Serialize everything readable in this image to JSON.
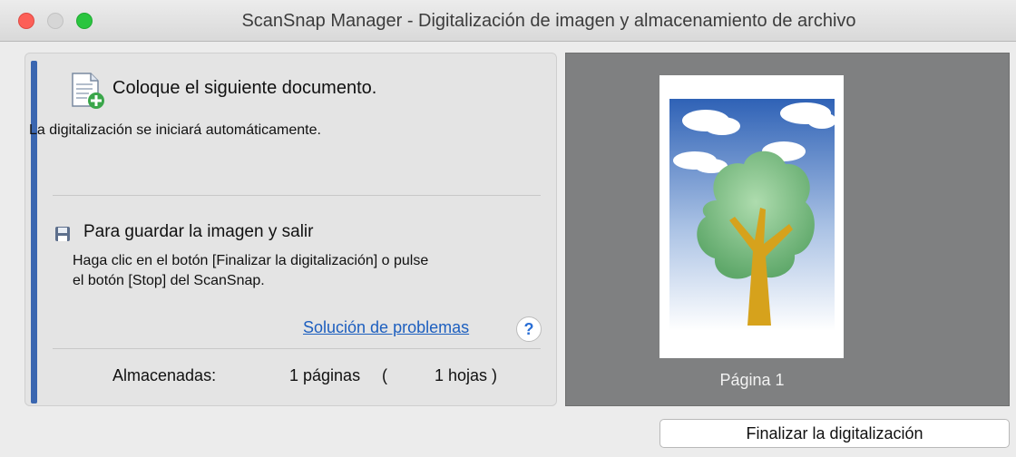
{
  "window": {
    "title": "ScanSnap Manager - Digitalización de imagen y almacenamiento de archivo"
  },
  "instructions": {
    "heading": "Coloque el siguiente documento.",
    "subtext": "La digitalización se iniciará automáticamente.",
    "save_heading": "Para guardar la imagen y salir",
    "save_line1": "Haga clic en el botón [Finalizar la digitalización] o pulse",
    "save_line2": "el botón [Stop] del ScanSnap."
  },
  "links": {
    "troubleshooting": "Solución de problemas",
    "help": "?"
  },
  "stored": {
    "label": "Almacenadas:",
    "pages": "1 páginas",
    "paren_open": "(",
    "sheets": "1 hojas )"
  },
  "preview": {
    "page_label": "Página 1"
  },
  "buttons": {
    "finish": "Finalizar la digitalización"
  },
  "icons": [
    "document-add-icon",
    "floppy-disk-icon",
    "help-icon"
  ],
  "colors": {
    "accent": "#3a66b0",
    "link": "#1d5fbf",
    "preview_bg": "#7f8081"
  }
}
